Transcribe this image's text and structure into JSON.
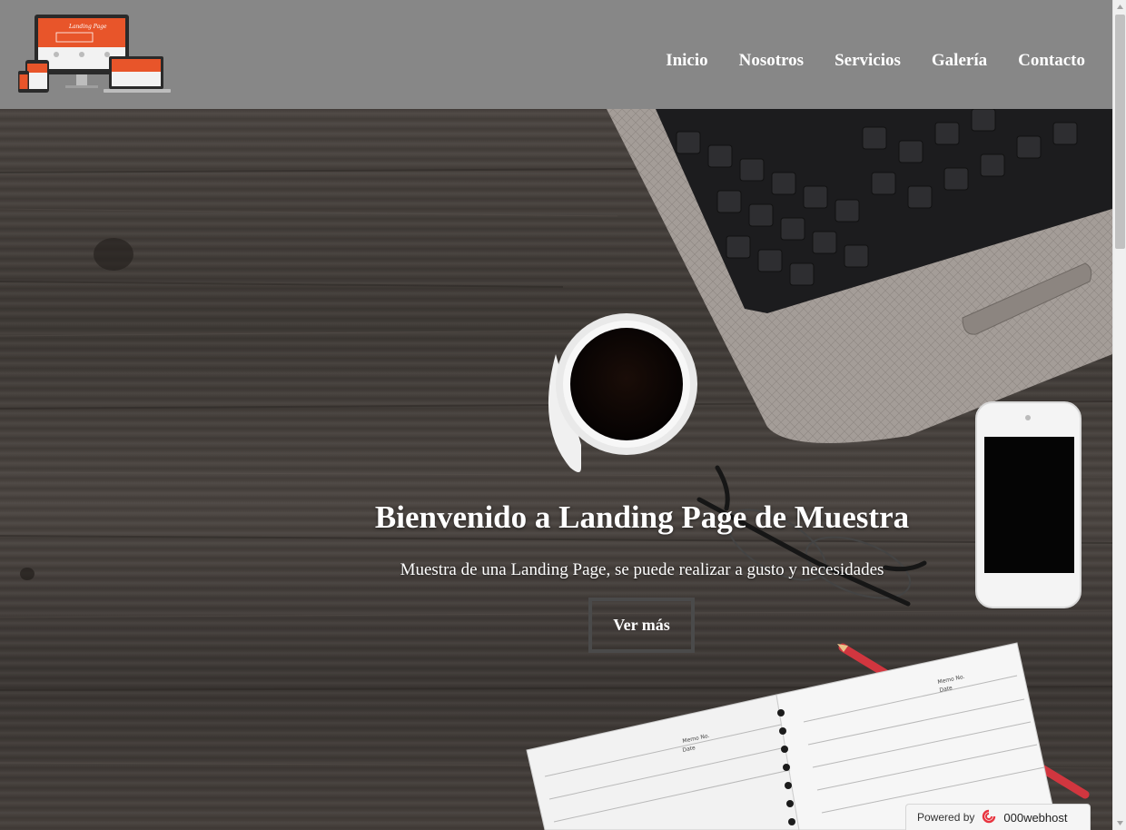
{
  "logo": {
    "text": "Landing Page"
  },
  "nav": {
    "items": [
      {
        "label": "Inicio"
      },
      {
        "label": "Nosotros"
      },
      {
        "label": "Servicios"
      },
      {
        "label": "Galería"
      },
      {
        "label": "Contacto"
      }
    ]
  },
  "hero": {
    "title": "Bienvenido a Landing Page de Muestra",
    "subtitle": "Muestra de una Landing Page, se puede realizar a gusto y necesidades",
    "button_label": "Ver más",
    "notebook_label_memo": "Memo No.",
    "notebook_label_date": "Date"
  },
  "badge": {
    "powered": "Powered by",
    "brand": "000webhost"
  },
  "colors": {
    "header_bg": "#878787",
    "accent_orange": "#e8552a",
    "button_border": "#4a4a4a"
  }
}
